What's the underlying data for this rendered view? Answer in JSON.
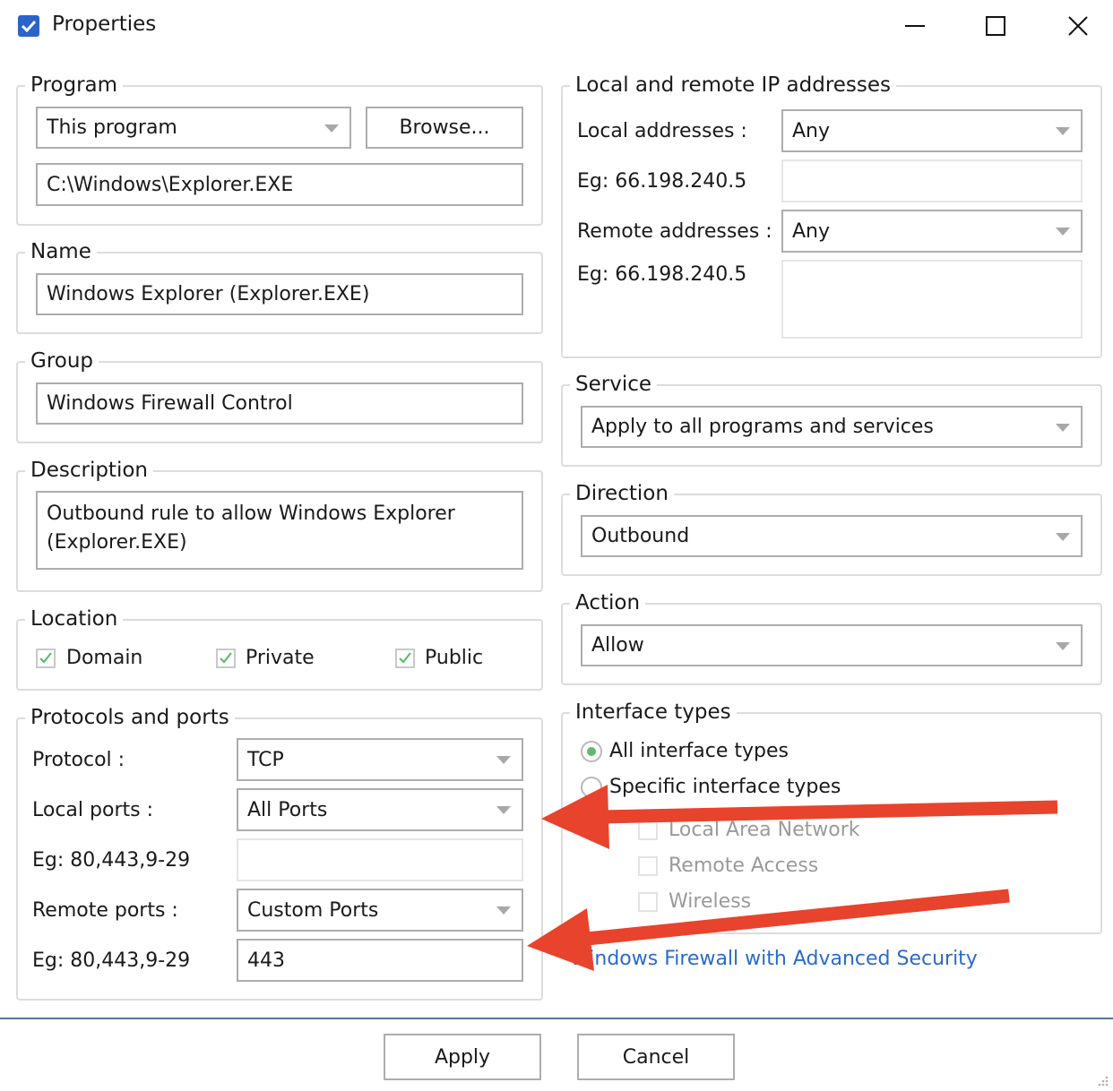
{
  "window": {
    "title": "Properties"
  },
  "program": {
    "label": "Program",
    "mode": "This program",
    "browse_label": "Browse...",
    "path": "C:\\Windows\\Explorer.EXE"
  },
  "name": {
    "label": "Name",
    "value": "Windows Explorer (Explorer.EXE)"
  },
  "group": {
    "label": "Group",
    "value": "Windows Firewall Control"
  },
  "description": {
    "label": "Description",
    "value": "Outbound rule to allow Windows Explorer (Explorer.EXE)"
  },
  "location": {
    "label": "Location",
    "domain": {
      "label": "Domain",
      "checked": true
    },
    "private": {
      "label": "Private",
      "checked": true
    },
    "public": {
      "label": "Public",
      "checked": true
    }
  },
  "protocols": {
    "label": "Protocols and ports",
    "protocol_label": "Protocol :",
    "protocol_value": "TCP",
    "local_ports_label": "Local ports :",
    "local_ports_value": "All Ports",
    "local_example": "Eg: 80,443,9-29",
    "local_custom_value": "",
    "remote_ports_label": "Remote ports :",
    "remote_ports_value": "Custom Ports",
    "remote_example": "Eg: 80,443,9-29",
    "remote_custom_value": "443"
  },
  "addresses": {
    "label": "Local and remote IP addresses",
    "local_label": "Local addresses :",
    "local_value": "Any",
    "local_example": "Eg: 66.198.240.5",
    "local_custom_value": "",
    "remote_label": "Remote addresses :",
    "remote_value": "Any",
    "remote_example": "Eg: 66.198.240.5",
    "remote_custom_value": ""
  },
  "service": {
    "label": "Service",
    "value": "Apply to all programs and services"
  },
  "direction": {
    "label": "Direction",
    "value": "Outbound"
  },
  "action": {
    "label": "Action",
    "value": "Allow"
  },
  "interface_types": {
    "label": "Interface types",
    "all_label": "All interface types",
    "specific_label": "Specific interface types",
    "lan_label": "Local Area Network",
    "remote_access_label": "Remote Access",
    "wireless_label": "Wireless"
  },
  "advanced_link": "Windows Firewall with Advanced Security",
  "footer": {
    "apply_label": "Apply",
    "cancel_label": "Cancel"
  },
  "colors": {
    "accent": "#2b63c9",
    "check_green": "#5fba6a",
    "link": "#2a6acb",
    "annotation_arrow": "#e8432c"
  }
}
